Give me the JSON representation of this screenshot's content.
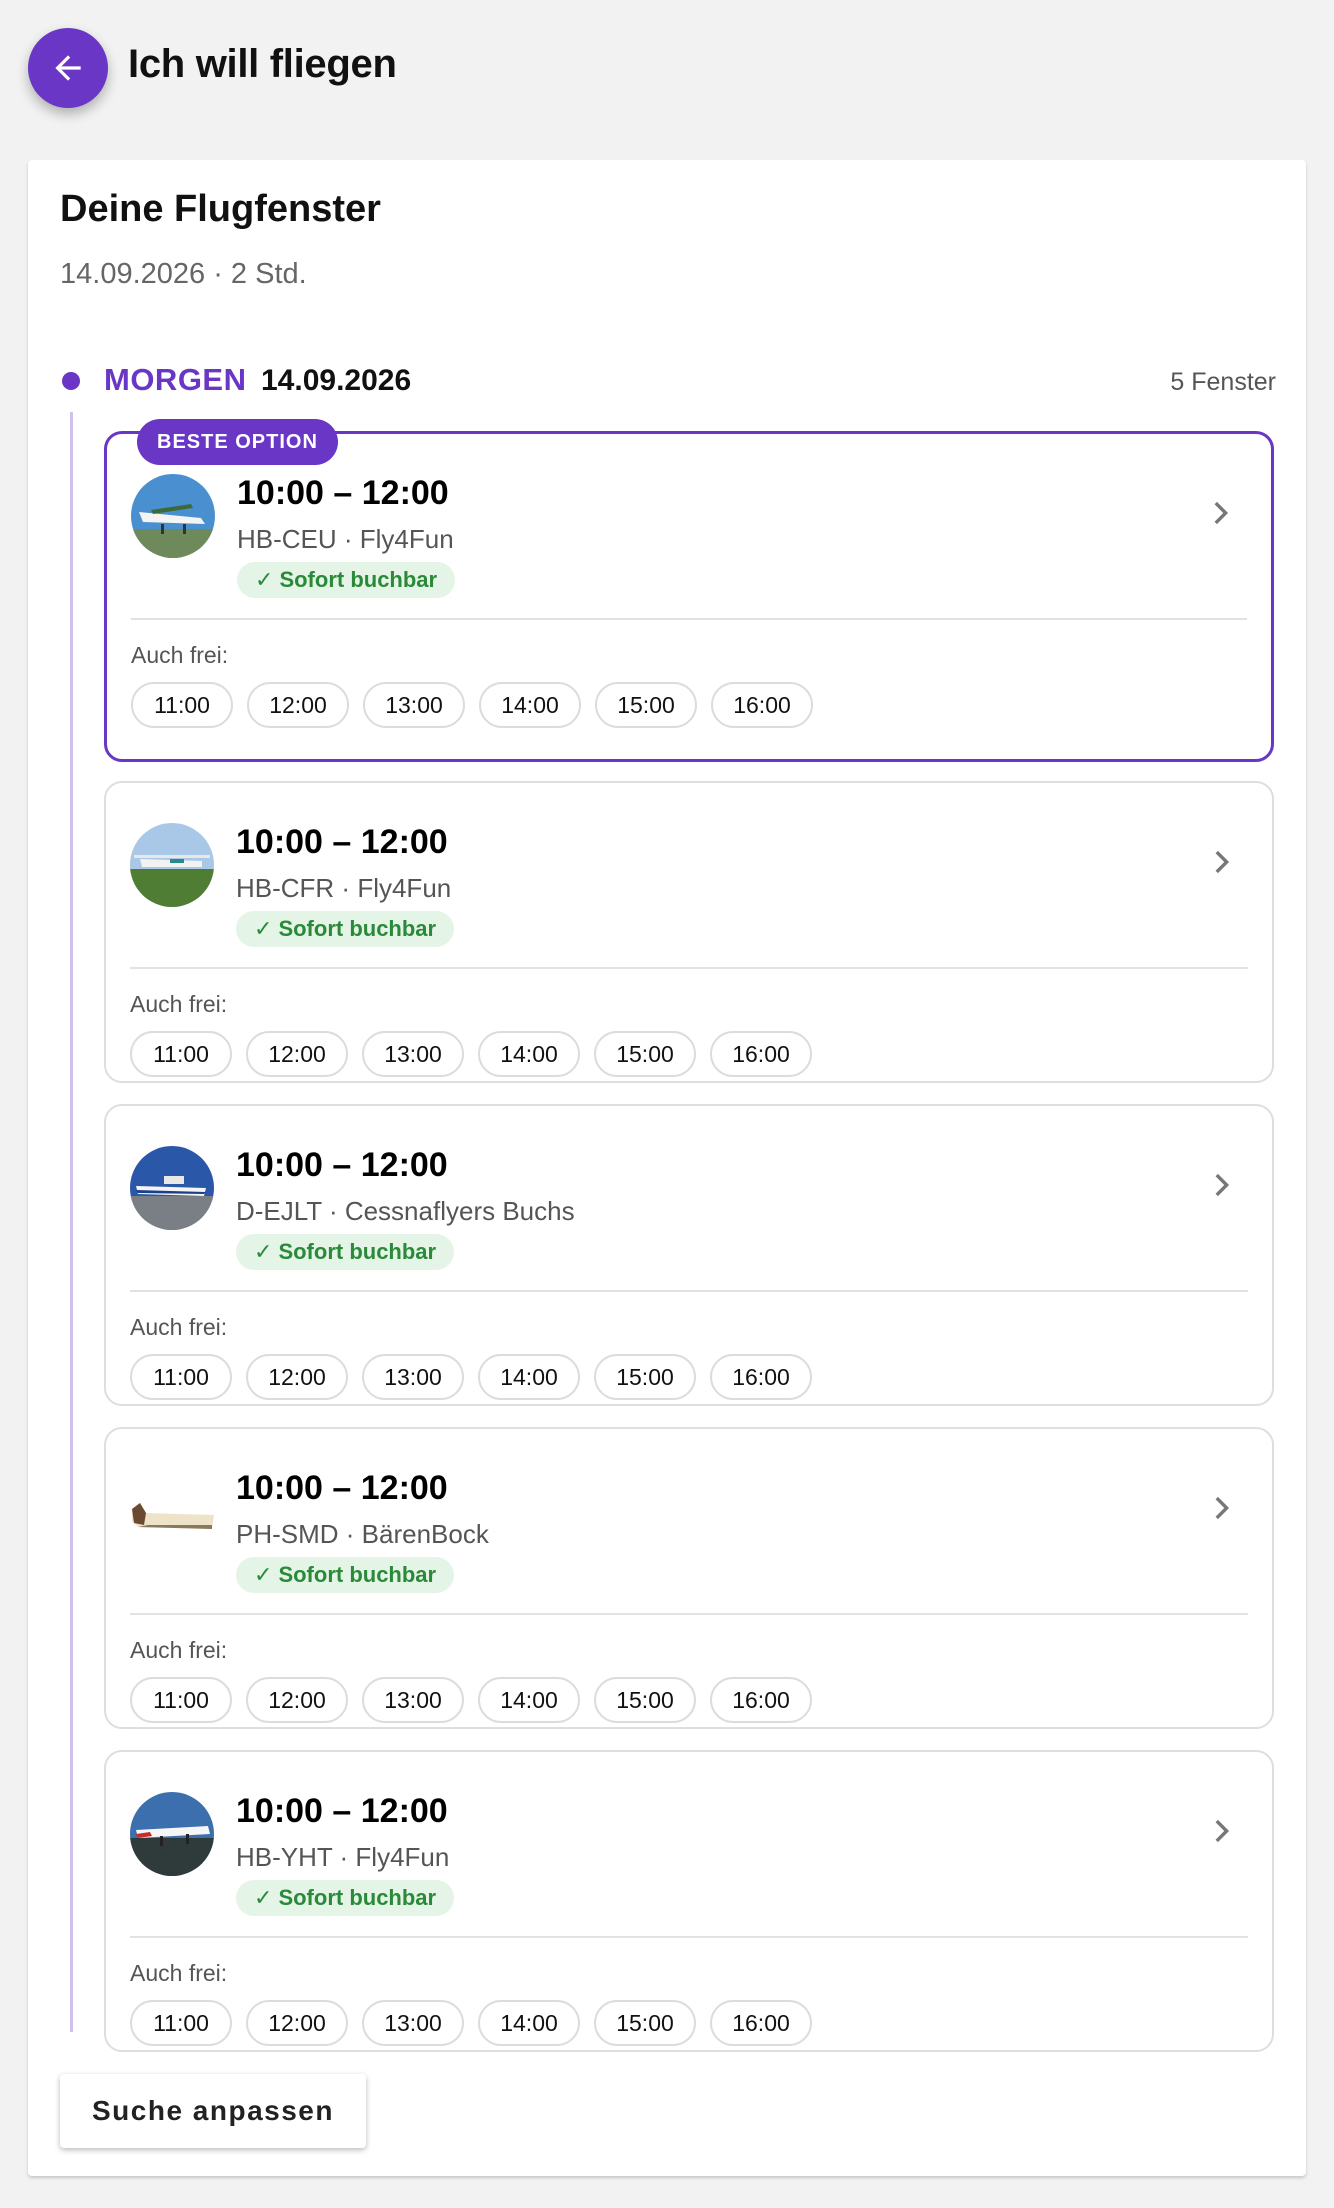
{
  "header": {
    "title": "Ich will fliegen",
    "back_icon": "arrow-left-icon"
  },
  "colors": {
    "accent": "#6a36c6",
    "success_bg": "#e4f4e6",
    "success_text": "#2b8a3a",
    "timeline": "#cfc2ea"
  },
  "panel": {
    "title": "Deine Flugfenster",
    "subtitle": "14.09.2026 · 2 Std."
  },
  "day": {
    "label": "MORGEN",
    "date": "14.09.2026",
    "count": "5 Fenster"
  },
  "best_badge": "BESTE OPTION",
  "also_label": "Auch frei:",
  "bookable_check": "✓",
  "cards": [
    {
      "time": "10:00 – 12:00",
      "reg": "HB-CEU · Fly4Fun",
      "status": "Sofort buchbar",
      "slots": [
        "11:00",
        "12:00",
        "13:00",
        "14:00",
        "15:00",
        "16:00"
      ]
    },
    {
      "time": "10:00 – 12:00",
      "reg": "HB-CFR · Fly4Fun",
      "status": "Sofort buchbar",
      "slots": [
        "11:00",
        "12:00",
        "13:00",
        "14:00",
        "15:00",
        "16:00"
      ]
    },
    {
      "time": "10:00 – 12:00",
      "reg": "D-EJLT · Cessnaflyers Buchs",
      "status": "Sofort buchbar",
      "slots": [
        "11:00",
        "12:00",
        "13:00",
        "14:00",
        "15:00",
        "16:00"
      ]
    },
    {
      "time": "10:00 – 12:00",
      "reg": "PH-SMD · BärenBock",
      "status": "Sofort buchbar",
      "slots": [
        "11:00",
        "12:00",
        "13:00",
        "14:00",
        "15:00",
        "16:00"
      ]
    },
    {
      "time": "10:00 – 12:00",
      "reg": "HB-YHT · Fly4Fun",
      "status": "Sofort buchbar",
      "slots": [
        "11:00",
        "12:00",
        "13:00",
        "14:00",
        "15:00",
        "16:00"
      ]
    }
  ],
  "adjust_button": "Suche anpassen"
}
